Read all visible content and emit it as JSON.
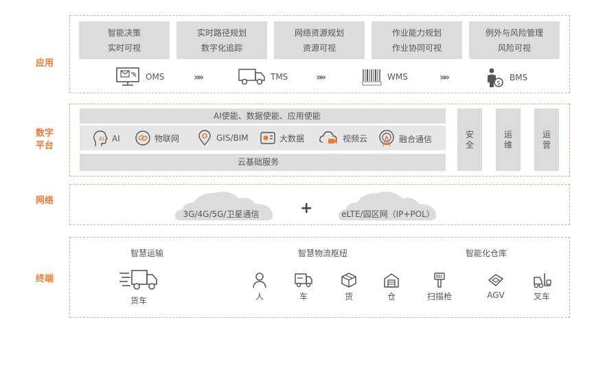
{
  "sections": {
    "app": "应用",
    "platform_line1": "数字",
    "platform_line2": "平台",
    "network": "网络",
    "terminal": "终端"
  },
  "app_cells": [
    {
      "line1": "智能决策",
      "line2": "实时可视"
    },
    {
      "line1": "实时路径规划",
      "line2": "数字化追踪"
    },
    {
      "line1": "网络资源规划",
      "line2": "资源可视"
    },
    {
      "line1": "作业能力规划",
      "line2": "作业协同可视"
    },
    {
      "line1": "例外与风险管理",
      "line2": "风险可视"
    }
  ],
  "systems": {
    "oms": "OMS",
    "tms": "TMS",
    "wms": "WMS",
    "bms": "BMS",
    "arrow": "»»"
  },
  "platform": {
    "top_row": "AI使能、数据使能、应用使能",
    "items": [
      "AI",
      "物联网",
      "GIS/BIM",
      "大数据",
      "视频云",
      "融合通信"
    ],
    "bottom_row": "云基础服务",
    "side_cols": [
      {
        "line1": "安",
        "line2": "全"
      },
      {
        "line1": "运",
        "line2": "维"
      },
      {
        "line1": "运",
        "line2": "营"
      }
    ]
  },
  "network": {
    "left": "3G/4G/5G/卫星通信",
    "plus": "+",
    "right": "eLTE/园区网（IP+POL）"
  },
  "terminal": {
    "group1_title": "智慧运输",
    "group2_title": "智慧物流枢纽",
    "group3_title": "智能化仓库",
    "truck": "货车",
    "person": "人",
    "car": "车",
    "goods": "货",
    "warehouse": "仓",
    "scanner": "扫描枪",
    "agv": "AGV",
    "forklift": "叉车"
  },
  "colors": {
    "accent": "#ee7a34",
    "panel_gray": "#dcdcdc",
    "dashed_border": "#b9b9b9"
  }
}
